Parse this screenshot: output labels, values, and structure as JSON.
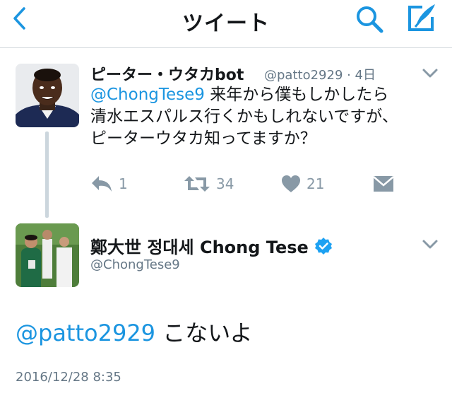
{
  "header": {
    "title": "ツイート",
    "back_icon": "chevron-left-icon",
    "search_icon": "search-icon",
    "compose_icon": "compose-tweet-icon",
    "accent": "#1b95e0"
  },
  "original_tweet": {
    "display_name": "ピーター・ウタカbot",
    "handle": "@patto2929 · 4日",
    "text_mention": "@ChongTese9",
    "text_line1": " 来年から僕もしかしたら",
    "text_line2": "清水エスパルス行くかもしれないですが、",
    "text_line3": "ピーターウタカ知ってますか？",
    "actions": {
      "reply_count": "1",
      "retweet_count": "34",
      "like_count": "21"
    }
  },
  "reply_tweet": {
    "display_name": "鄭大世 정대세 Chong Tese",
    "handle": "@ChongTese9",
    "text_mention": "@patto2929",
    "text_body": " こないよ",
    "timestamp": "2016/12/28 8:35",
    "verified_color": "#1da1f2"
  }
}
